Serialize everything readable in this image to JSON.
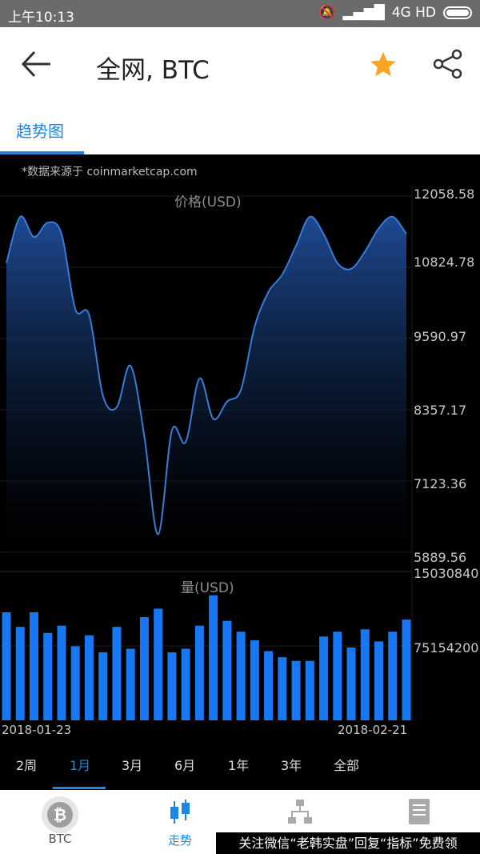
{
  "status_bar": {
    "time": "上午10:13",
    "network": "4G HD"
  },
  "header": {
    "title": "全网, BTC",
    "back_icon": "arrow-left-icon",
    "favorite_icon": "star-icon",
    "share_icon": "share-icon",
    "star_color": "#f5a623"
  },
  "tabs": [
    {
      "label": "趋势图",
      "active": true
    }
  ],
  "chart": {
    "source_note": "*数据来源于 coinmarketcap.com",
    "price_label": "价格(USD)",
    "volume_label": "量(USD)",
    "price_ticks": [
      "12058.58",
      "10824.78",
      "9590.97",
      "8357.17",
      "7123.36",
      "5889.56"
    ],
    "volume_ticks": [
      "15030840",
      "75154200"
    ],
    "x_start": "2018-01-23",
    "x_end": "2018-02-21"
  },
  "chart_data": [
    {
      "type": "area",
      "title": "价格(USD)",
      "x": [
        "2018-01-23",
        "2018-01-24",
        "2018-01-25",
        "2018-01-26",
        "2018-01-27",
        "2018-01-28",
        "2018-01-29",
        "2018-01-30",
        "2018-01-31",
        "2018-02-01",
        "2018-02-02",
        "2018-02-03",
        "2018-02-04",
        "2018-02-05",
        "2018-02-06",
        "2018-02-07",
        "2018-02-08",
        "2018-02-09",
        "2018-02-10",
        "2018-02-11",
        "2018-02-12",
        "2018-02-13",
        "2018-02-14",
        "2018-02-15",
        "2018-02-16",
        "2018-02-17",
        "2018-02-18",
        "2018-02-19",
        "2018-02-20",
        "2018-02-21"
      ],
      "values": [
        10900,
        11700,
        11350,
        11600,
        11400,
        10100,
        10000,
        8600,
        8400,
        9120,
        7900,
        6200,
        8000,
        7800,
        8900,
        8200,
        8500,
        8700,
        9800,
        10400,
        10700,
        11200,
        11700,
        11400,
        10900,
        10800,
        11100,
        11500,
        11700,
        11400
      ],
      "ylim": [
        5889.56,
        12058.58
      ]
    },
    {
      "type": "bar",
      "title": "量(USD)",
      "x": [
        "2018-01-23",
        "2018-01-24",
        "2018-01-25",
        "2018-01-26",
        "2018-01-27",
        "2018-01-28",
        "2018-01-29",
        "2018-01-30",
        "2018-01-31",
        "2018-02-01",
        "2018-02-02",
        "2018-02-03",
        "2018-02-04",
        "2018-02-05",
        "2018-02-06",
        "2018-02-07",
        "2018-02-08",
        "2018-02-09",
        "2018-02-10",
        "2018-02-11",
        "2018-02-12",
        "2018-02-13",
        "2018-02-14",
        "2018-02-15",
        "2018-02-16",
        "2018-02-17",
        "2018-02-18",
        "2018-02-19",
        "2018-02-20",
        "2018-02-21"
      ],
      "values": [
        8900000,
        7700000,
        8900000,
        7200000,
        7800000,
        6100000,
        7000000,
        5600000,
        7700000,
        5900000,
        8500000,
        9200000,
        5600000,
        5900000,
        7800000,
        10300000,
        8200000,
        7300000,
        6600000,
        5700000,
        5200000,
        4900000,
        4900000,
        6900000,
        7300000,
        6000000,
        7500000,
        6500000,
        7300000,
        8300000
      ],
      "ylim": [
        0,
        12000000
      ]
    }
  ],
  "ranges": [
    "2周",
    "1月",
    "3月",
    "6月",
    "1年",
    "3年",
    "全部"
  ],
  "active_range": "1月",
  "bottom_nav": [
    {
      "label": "BTC",
      "icon": "bitcoin-icon"
    },
    {
      "label": "走势",
      "icon": "candlestick-icon",
      "active": true
    },
    {
      "label": "",
      "icon": "sitemap-icon"
    },
    {
      "label": "",
      "icon": "document-icon"
    }
  ],
  "ad_text": "关注微信“老韩实盘”回复“指标”免费领",
  "colors": {
    "accent": "#1f86e0",
    "line": "#3a7bd5",
    "bar": "#1877f2",
    "chart_bg": "#000000"
  }
}
